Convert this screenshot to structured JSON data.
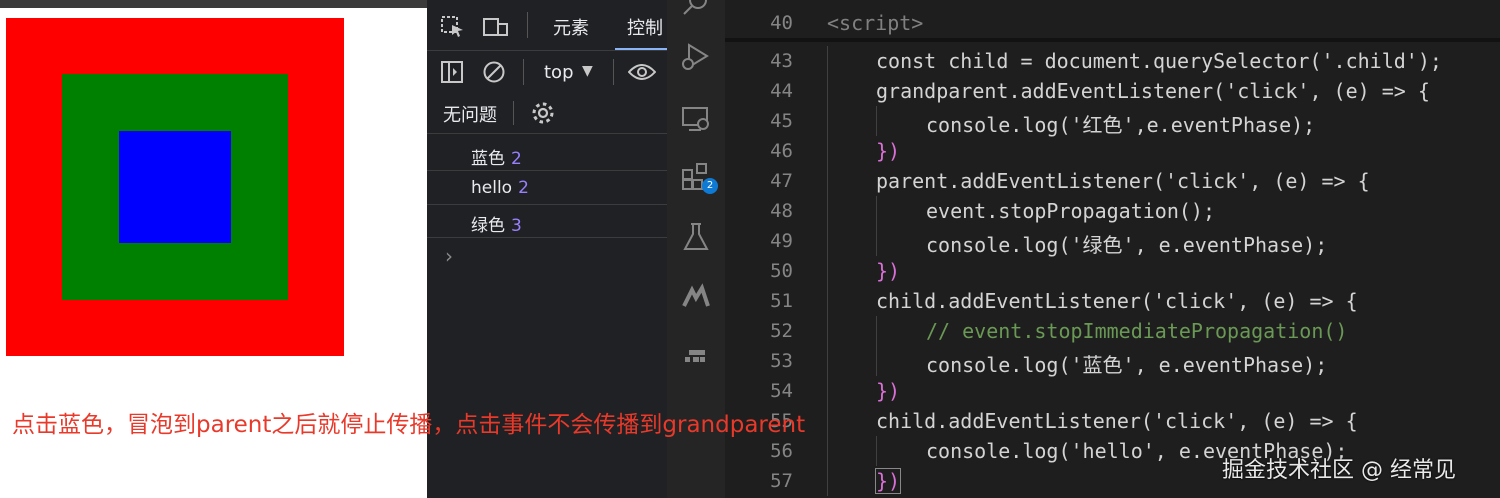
{
  "devtools": {
    "tabs": {
      "elements": "元素",
      "console": "控制"
    },
    "context": "top",
    "issues": "无问题",
    "messages": [
      {
        "text": "蓝色",
        "count": "2"
      },
      {
        "text": "hello",
        "count": "2"
      },
      {
        "text": "绿色",
        "count": "3"
      }
    ]
  },
  "activity_bar": {
    "badge": "2"
  },
  "editor": {
    "sticky": {
      "num": "40",
      "text": "<script>"
    },
    "lines": [
      {
        "num": "43",
        "text": "const child = document.querySelector('.child');"
      },
      {
        "num": "44",
        "text": "grandparent.addEventListener('click', (e) => {"
      },
      {
        "num": "45",
        "text": "console.log('红色',e.eventPhase);"
      },
      {
        "num": "46",
        "text": "})"
      },
      {
        "num": "47",
        "text": "parent.addEventListener('click', (e) => {"
      },
      {
        "num": "48",
        "text": "event.stopPropagation();"
      },
      {
        "num": "49",
        "text": "console.log('绿色', e.eventPhase);"
      },
      {
        "num": "50",
        "text": "})"
      },
      {
        "num": "51",
        "text": "child.addEventListener('click', (e) => {"
      },
      {
        "num": "52",
        "text": "// event.stopImmediatePropagation()"
      },
      {
        "num": "53",
        "text": "console.log('蓝色', e.eventPhase);"
      },
      {
        "num": "54",
        "text": "})"
      },
      {
        "num": "55",
        "text": "child.addEventListener('click', (e) => {"
      },
      {
        "num": "56",
        "text": "console.log('hello', e.eventPhase);"
      },
      {
        "num": "57",
        "text": "})"
      }
    ]
  },
  "annotation": "点击蓝色，冒泡到parent之后就停止传播，点击事件不会传播到grandparent",
  "watermark": "掘金技术社区 @ 经常见",
  "colors": {
    "red": "#ff0000",
    "green": "#008000",
    "blue": "#0000ff",
    "annotation": "#e8392a"
  }
}
